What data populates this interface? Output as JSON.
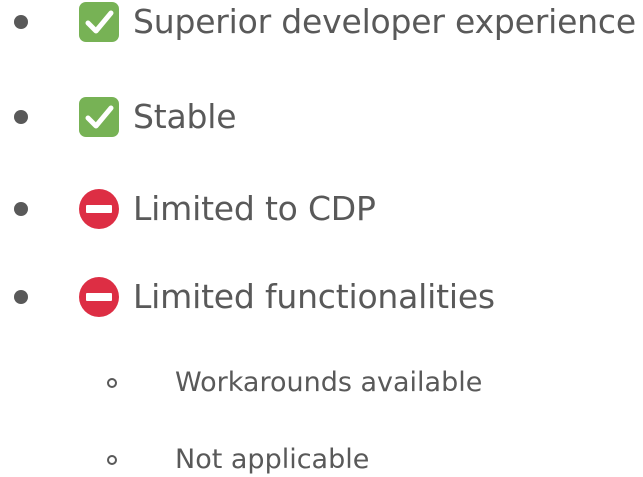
{
  "colors": {
    "text": "#595959",
    "check_bg": "#77b255",
    "noentry_bg": "#dd2e44"
  },
  "items": [
    {
      "icon": "check-mark-icon",
      "label": "Superior developer experience"
    },
    {
      "icon": "check-mark-icon",
      "label": "Stable"
    },
    {
      "icon": "no-entry-icon",
      "label": "Limited to CDP"
    },
    {
      "icon": "no-entry-icon",
      "label": "Limited functionalities"
    }
  ],
  "sub_items": [
    {
      "label": "Workarounds available"
    },
    {
      "label": "Not applicable"
    }
  ]
}
